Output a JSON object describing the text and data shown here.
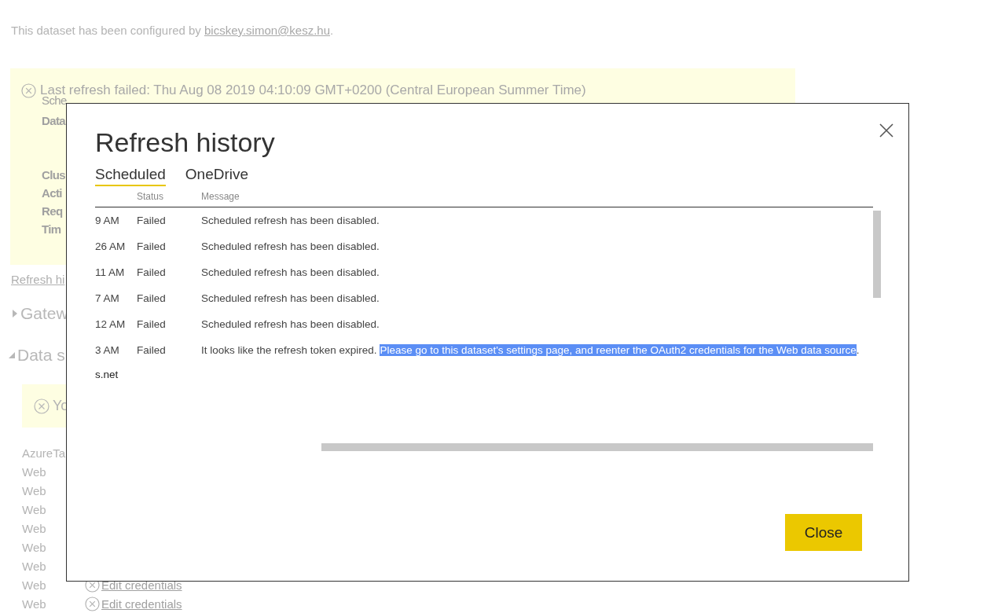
{
  "configured": {
    "text": "This dataset has been configured by ",
    "email": "bicskey.simon@kesz.hu",
    "end": "."
  },
  "refresh_banner": {
    "status_text": "Last refresh failed: Thu Aug 08 2019 04:10:09 GMT+0200 (Central European Summer Time)",
    "lines": [
      {
        "text": "Sche",
        "bold": false
      },
      {
        "text": "Data",
        "bold": true
      },
      {
        "text": "Clus",
        "bold": true
      },
      {
        "text": "Acti",
        "bold": true
      },
      {
        "text": "Req",
        "bold": true
      },
      {
        "text": "Tim",
        "bold": true
      }
    ]
  },
  "refresh_history_link": "Refresh hi",
  "sections": [
    {
      "label": "Gatew",
      "expanded": false
    },
    {
      "label": "Data s",
      "expanded": true
    }
  ],
  "data_source_alert": "Yo",
  "data_sources": [
    {
      "type": "AzureTa"
    },
    {
      "type": "Web"
    },
    {
      "type": "Web"
    },
    {
      "type": "Web"
    },
    {
      "type": "Web"
    },
    {
      "type": "Web"
    },
    {
      "type": "Web"
    },
    {
      "type": "Web",
      "action": "Edit credentials"
    },
    {
      "type": "Web",
      "action": "Edit credentials"
    }
  ],
  "dialog": {
    "title": "Refresh history",
    "tabs": [
      {
        "label": "Scheduled",
        "selected": true
      },
      {
        "label": "OneDrive",
        "selected": false
      }
    ],
    "columns": [
      "Status",
      "Message"
    ],
    "rows": [
      {
        "time": "9 AM",
        "status": "Failed",
        "message": "Scheduled refresh has been disabled."
      },
      {
        "time": "26 AM",
        "status": "Failed",
        "message": "Scheduled refresh has been disabled."
      },
      {
        "time": "11 AM",
        "status": "Failed",
        "message": "Scheduled refresh has been disabled."
      },
      {
        "time": "7 AM",
        "status": "Failed",
        "message": "Scheduled refresh has been disabled."
      },
      {
        "time": "12 AM",
        "status": "Failed",
        "message": "Scheduled refresh has been disabled."
      },
      {
        "time": "3 AM",
        "status": "Failed",
        "message": "It looks like the refresh token expired. ",
        "selected_text": "Please go to this dataset's settings page, and reenter the OAuth2 credentials for the Web data source",
        "message_end": "."
      }
    ],
    "footer_text": "s.net",
    "close_button": "Close"
  }
}
